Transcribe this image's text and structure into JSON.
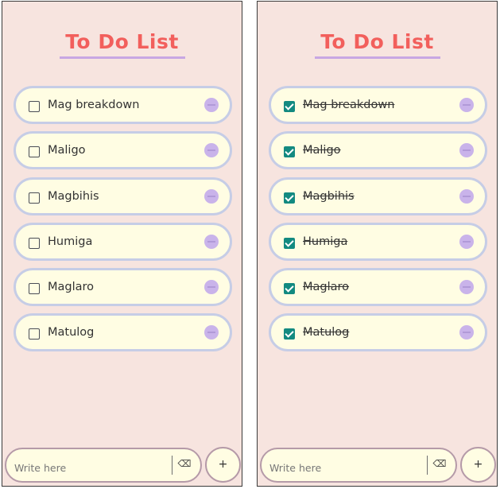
{
  "colors": {
    "panel_background": "#f7e4df",
    "title": "#f25f5c",
    "title_underline": "#c8a7e3",
    "item_background": "#fffde3",
    "item_border": "#c6cde6",
    "checkbox_checked": "#138a80",
    "remove_button": "#c9b3ea",
    "input_border": "#b59aa8"
  },
  "panels": [
    {
      "title": "To Do List",
      "items": [
        {
          "label": "Mag breakdown",
          "checked": false
        },
        {
          "label": "Maligo",
          "checked": false
        },
        {
          "label": "Magbihis",
          "checked": false
        },
        {
          "label": "Humiga",
          "checked": false
        },
        {
          "label": "Maglaro",
          "checked": false
        },
        {
          "label": "Matulog",
          "checked": false
        }
      ],
      "input": {
        "placeholder": "Write here",
        "value": ""
      },
      "clear_button": {
        "label": "⌫",
        "icon": "backspace-icon"
      },
      "add_button": {
        "label": "+"
      }
    },
    {
      "title": "To Do List",
      "items": [
        {
          "label": "Mag breakdown",
          "checked": true
        },
        {
          "label": "Maligo",
          "checked": true
        },
        {
          "label": "Magbihis",
          "checked": true
        },
        {
          "label": "Humiga",
          "checked": true
        },
        {
          "label": "Maglaro",
          "checked": true
        },
        {
          "label": "Matulog",
          "checked": true
        }
      ],
      "input": {
        "placeholder": "Write here",
        "value": ""
      },
      "clear_button": {
        "label": "⌫",
        "icon": "backspace-icon"
      },
      "add_button": {
        "label": "+"
      }
    }
  ]
}
